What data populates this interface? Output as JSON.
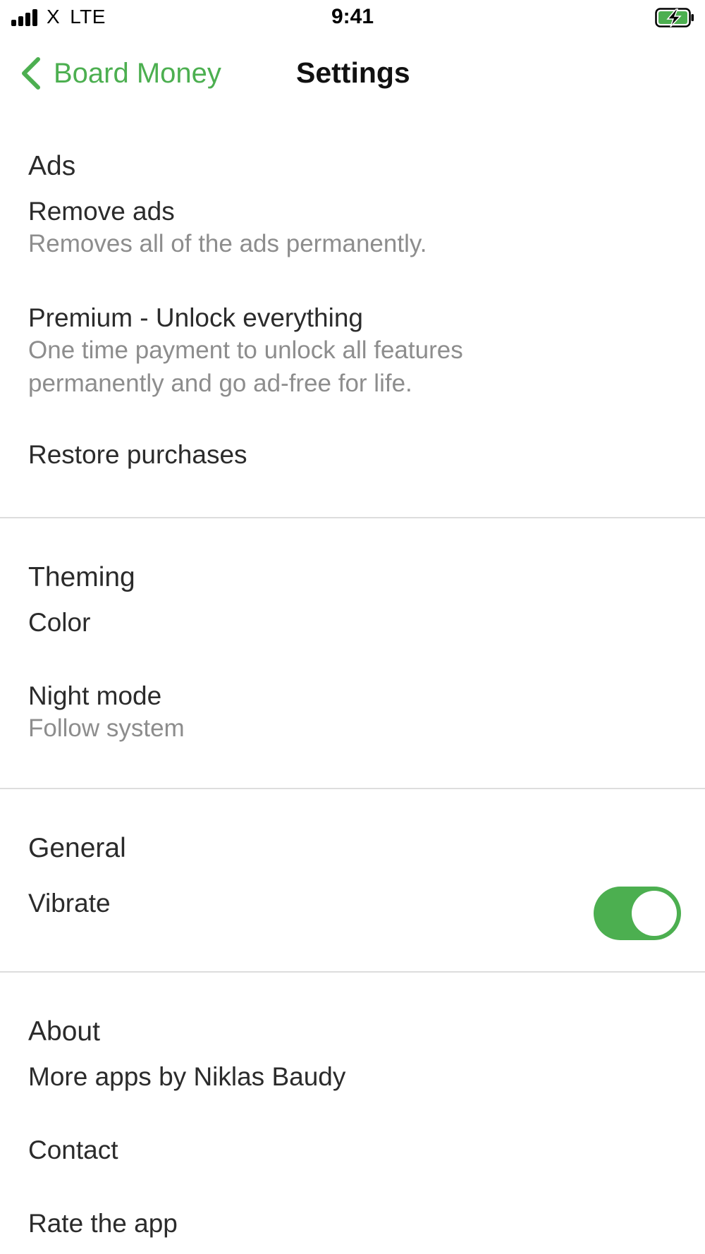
{
  "status_bar": {
    "carrier": "X",
    "network": "LTE",
    "time": "9:41",
    "battery_state": "charging",
    "signal_bars": 4
  },
  "nav": {
    "back_label": "Board Money",
    "title": "Settings"
  },
  "colors": {
    "accent": "#4caf50",
    "text": "#2b2b2b",
    "secondary_text": "#8d8d8d",
    "divider": "#dddddd"
  },
  "sections": {
    "ads": {
      "header": "Ads",
      "remove_ads": {
        "title": "Remove ads",
        "subtitle": "Removes all of the ads permanently."
      },
      "premium": {
        "title": "Premium - Unlock everything",
        "subtitle": "One time payment to unlock all features permanently and go ad-free for life."
      },
      "restore": {
        "title": "Restore purchases"
      }
    },
    "theming": {
      "header": "Theming",
      "color": {
        "title": "Color"
      },
      "night_mode": {
        "title": "Night mode",
        "subtitle": "Follow system"
      }
    },
    "general": {
      "header": "General",
      "vibrate": {
        "title": "Vibrate",
        "enabled": true
      }
    },
    "about": {
      "header": "About",
      "more_apps": {
        "title": "More apps by Niklas Baudy"
      },
      "contact": {
        "title": "Contact"
      },
      "rate": {
        "title": "Rate the app"
      }
    }
  }
}
